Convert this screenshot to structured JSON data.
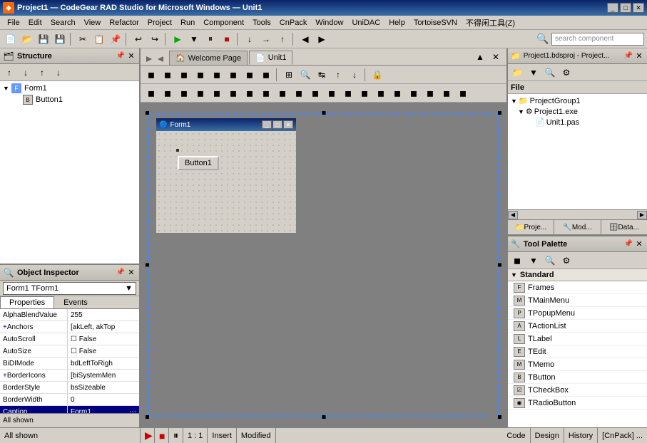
{
  "titlebar": {
    "title": "Project1 — CodeGear RAD Studio for Microsoft Windows — Unit1",
    "app_icon": "◆",
    "min": "_",
    "max": "□",
    "close": "✕"
  },
  "menubar": {
    "items": [
      "File",
      "Edit",
      "Search",
      "View",
      "Refactor",
      "Project",
      "Run",
      "Component",
      "Tools",
      "CnPack",
      "Window",
      "UniDAC",
      "Help",
      "TortoiseSVN",
      "不得闲工具(Z)"
    ]
  },
  "toolbar": {
    "search_placeholder": "search component"
  },
  "structure": {
    "title": "Structure",
    "items": [
      {
        "label": "Form1",
        "type": "form",
        "expanded": true
      },
      {
        "label": "Button1",
        "type": "button",
        "indent": 2
      }
    ]
  },
  "object_inspector": {
    "title": "Object Inspector",
    "component": "Form1",
    "component_type": "TForm1",
    "tabs": [
      "Properties",
      "Events"
    ],
    "active_tab": "Properties",
    "properties": [
      {
        "name": "AlphaBlendValue",
        "value": "255",
        "expand": false
      },
      {
        "name": "Anchors",
        "value": "[akLeft, akTop",
        "expand": true,
        "highlighted": false
      },
      {
        "name": "AutoScroll",
        "value": "□ False",
        "expand": false
      },
      {
        "name": "AutoSize",
        "value": "□ False",
        "expand": false
      },
      {
        "name": "BiDIMode",
        "value": "bdLeftToRigh",
        "expand": false
      },
      {
        "name": "BorderIcons",
        "value": "[biSystemMen",
        "expand": true
      },
      {
        "name": "BorderStyle",
        "value": "bsSizeable",
        "expand": false
      },
      {
        "name": "BorderWidth",
        "value": "0",
        "expand": false
      },
      {
        "name": "Caption",
        "value": "Form1",
        "expand": false,
        "highlighted": true
      }
    ],
    "status": "All shown"
  },
  "editor": {
    "tabs": [
      {
        "label": "Welcome Page",
        "icon": "🏠",
        "active": false
      },
      {
        "label": "Unit1",
        "icon": "📄",
        "active": true
      }
    ],
    "form_title": "Form1",
    "button_label": "Button1"
  },
  "project_manager": {
    "title": "Project1.bdsproj - Project...",
    "file_header": "File",
    "tree": [
      {
        "label": "ProjectGroup1",
        "indent": 0,
        "icon": "📁"
      },
      {
        "label": "Project1.exe",
        "indent": 1,
        "icon": "⚙",
        "expanded": true
      },
      {
        "label": "Unit1.pas",
        "indent": 2,
        "icon": "📄"
      }
    ],
    "tabs": [
      "Proje...",
      "Mod...",
      "Data..."
    ]
  },
  "tool_palette": {
    "title": "Tool Palette",
    "sections": [
      {
        "name": "Standard",
        "items": [
          "Frames",
          "TMainMenu",
          "TPopupMenu",
          "TActionList",
          "TLabel",
          "TEdit",
          "TMemo",
          "TButton",
          "TCheckBox",
          "TRadioButton"
        ]
      }
    ]
  },
  "statusbar": {
    "all_shown": "All shown",
    "position": "1 : 1",
    "mode": "Insert",
    "status": "Modified",
    "tabs": [
      "Code",
      "Design",
      "History",
      "[CnPack] ..."
    ],
    "history": "History"
  },
  "icons": {
    "expand": "▶",
    "collapse": "▼",
    "minus": "−",
    "plus": "+",
    "close": "✕",
    "pin": "📌",
    "arrow_right": "▶",
    "check": "✓",
    "dot": "•",
    "folder": "📁",
    "form": "F",
    "component": "C"
  }
}
